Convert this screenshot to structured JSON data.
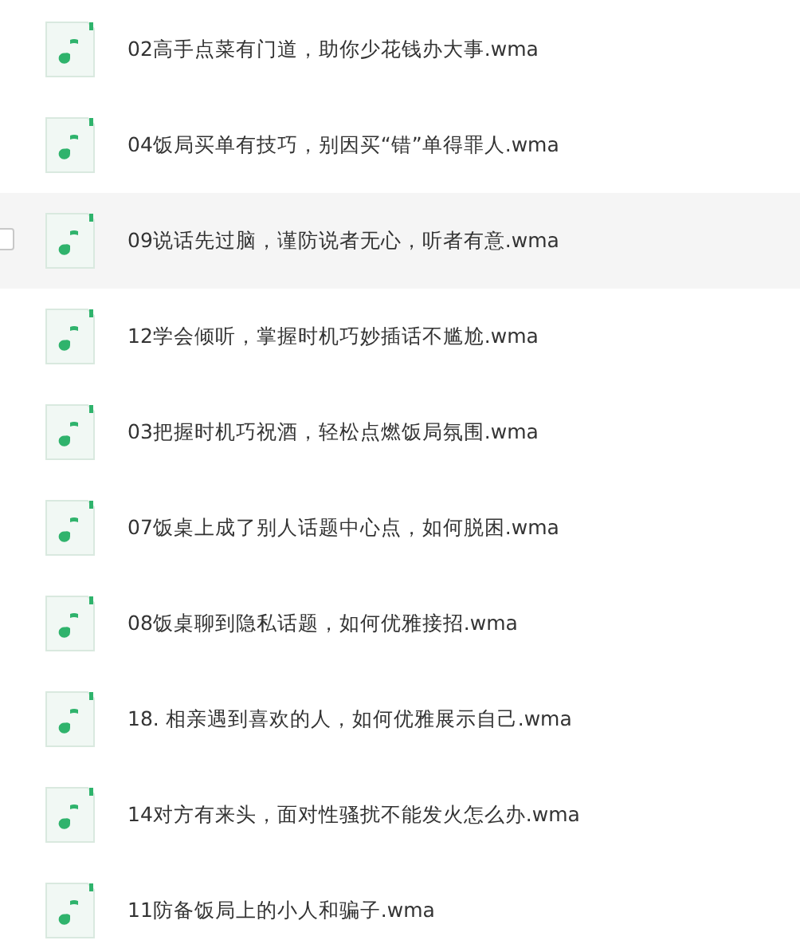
{
  "files": [
    {
      "name": "02高手点菜有门道，助你少花钱办大事.wma",
      "highlighted": false,
      "checked": false
    },
    {
      "name": "04饭局买单有技巧，别因买“错”单得罪人.wma",
      "highlighted": false,
      "checked": false
    },
    {
      "name": "09说话先过脑，谨防说者无心，听者有意.wma",
      "highlighted": true,
      "checked": false
    },
    {
      "name": "12学会倾听，掌握时机巧妙插话不尴尬.wma",
      "highlighted": false,
      "checked": false
    },
    {
      "name": "03把握时机巧祝酒，轻松点燃饭局氛围.wma",
      "highlighted": false,
      "checked": false
    },
    {
      "name": "07饭桌上成了别人话题中心点，如何脱困.wma",
      "highlighted": false,
      "checked": false
    },
    {
      "name": "08饭桌聊到隐私话题，如何优雅接招.wma",
      "highlighted": false,
      "checked": false
    },
    {
      "name": "18. 相亲遇到喜欢的人，如何优雅展示自己.wma",
      "highlighted": false,
      "checked": false
    },
    {
      "name": "14对方有来头，面对性骚扰不能发火怎么办.wma",
      "highlighted": false,
      "checked": false
    },
    {
      "name": "11防备饭局上的小人和骗子.wma",
      "highlighted": false,
      "checked": false
    }
  ]
}
